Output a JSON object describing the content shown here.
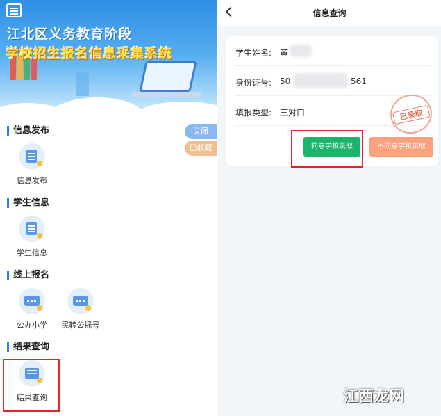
{
  "left_app": {
    "banner": {
      "title_line1": "江北区义务教育阶段",
      "title_line2": "学校招生报名信息采集系统"
    },
    "side_buttons": {
      "close_label": "关闭",
      "saved_label": "已收藏"
    },
    "sections": [
      {
        "title": "信息发布",
        "items": [
          {
            "label": "信息发布",
            "icon": "document-icon"
          }
        ]
      },
      {
        "title": "学生信息",
        "items": [
          {
            "label": "学生信息",
            "icon": "form-icon"
          }
        ]
      },
      {
        "title": "线上报名",
        "items": [
          {
            "label": "公办小学",
            "icon": "screen-icon"
          },
          {
            "label": "民转公摇号",
            "icon": "screen-icon"
          }
        ]
      },
      {
        "title": "结果查询",
        "items": [
          {
            "label": "结果查询",
            "icon": "results-icon"
          }
        ]
      }
    ]
  },
  "right_app": {
    "header": {
      "title": "信息查询",
      "back_icon": "chevron-left-icon"
    },
    "fields": [
      {
        "label": "学生姓名:",
        "value": "黄"
      },
      {
        "label": "身份证号:",
        "value_prefix": "50",
        "value_suffix": "561"
      },
      {
        "label": "填报类型:",
        "value": "三对口"
      }
    ],
    "stamp_text": "已录取",
    "buttons": {
      "agree_label": "同意学校录取",
      "disagree_label": "不同意学校录取"
    },
    "colors": {
      "agree": "#1bb46a",
      "disagree": "#f9a27d",
      "highlight": "#e2242b",
      "accent": "#2f7fe0"
    }
  },
  "watermark": "江西龙网"
}
